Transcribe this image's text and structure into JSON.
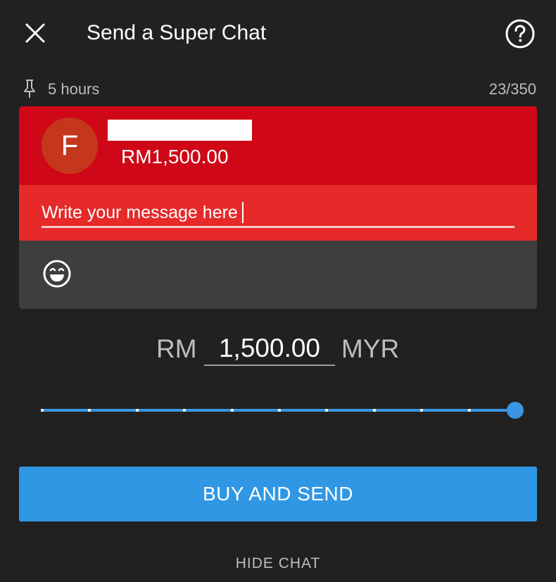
{
  "header": {
    "title": "Send a Super Chat",
    "close_icon": "close-icon",
    "help_icon": "help-circle-icon"
  },
  "info": {
    "pin_icon": "pin-icon",
    "duration": "5 hours",
    "char_count": "23/350"
  },
  "card": {
    "avatar_letter": "F",
    "amount": "RM1,500.00",
    "message_value": "Write your message here",
    "emoji_icon": "smiley-icon",
    "colors": {
      "header_bg": "#d00717",
      "message_bg": "#e62a29",
      "avatar_bg": "#c4371c"
    }
  },
  "amount": {
    "currency_prefix": "RM",
    "value": "1,500.00",
    "currency_code": "MYR"
  },
  "slider": {
    "steps": 11,
    "current_step": 10,
    "accent_color": "#3a95e3"
  },
  "actions": {
    "buy_label": "BUY AND SEND",
    "hide_chat_label": "HIDE CHAT",
    "buy_color": "#3097e4"
  }
}
